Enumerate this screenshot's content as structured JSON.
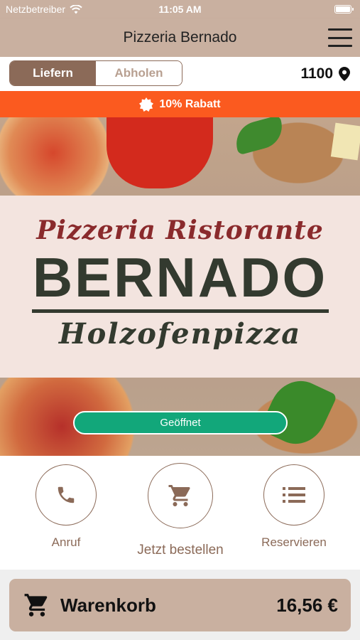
{
  "status_bar": {
    "carrier": "Netzbetreiber",
    "time": "11:05 AM",
    "battery_percent": 100
  },
  "header": {
    "title": "Pizzeria Bernado",
    "menu_icon": "hamburger-menu-icon"
  },
  "delivery": {
    "options": [
      "Liefern",
      "Abholen"
    ],
    "selected": "Liefern",
    "postal_code": "1100",
    "location_icon": "map-pin-icon"
  },
  "discount": {
    "text": "10% Rabatt",
    "icon": "badge-star-icon"
  },
  "logo": {
    "line1": "Pizzeria Ristorante",
    "line2": "BERNADO",
    "line3": "Holzofenpizza"
  },
  "open_status": "Geöffnet",
  "actions": [
    {
      "label": "Anruf",
      "icon": "phone-icon"
    },
    {
      "label": "Jetzt bestellen",
      "icon": "cart-icon"
    },
    {
      "label": "Reservieren",
      "icon": "list-icon"
    }
  ],
  "cart": {
    "label": "Warenkorb",
    "total": "16,56 €",
    "icon": "cart-icon"
  },
  "colors": {
    "brand": "#c9b0a0",
    "accent_brown": "#8b6a58",
    "discount": "#fb5a1f",
    "open": "#12a77a"
  }
}
